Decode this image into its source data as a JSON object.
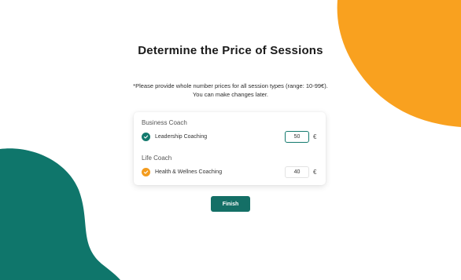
{
  "page": {
    "title": "Determine the Price of Sessions",
    "subtitle_line1": "*Please provide whole number prices for all session types (range: 10-99€).",
    "subtitle_line2": "You can make changes later."
  },
  "categories": [
    {
      "label": "Business Coach",
      "session": {
        "name": "Leadership Coaching",
        "price": "50",
        "currency": "€",
        "status_icon": "check-circle-icon",
        "status_color": "#137a6e"
      }
    },
    {
      "label": "Life Coach",
      "session": {
        "name": "Health & Wellnes Coaching",
        "price": "40",
        "currency": "€",
        "status_icon": "check-circle-icon",
        "status_color": "#f39c1f"
      }
    }
  ],
  "actions": {
    "finish_label": "Finish"
  },
  "colors": {
    "accent_teal": "#146f66",
    "accent_orange": "#f9a11f"
  }
}
